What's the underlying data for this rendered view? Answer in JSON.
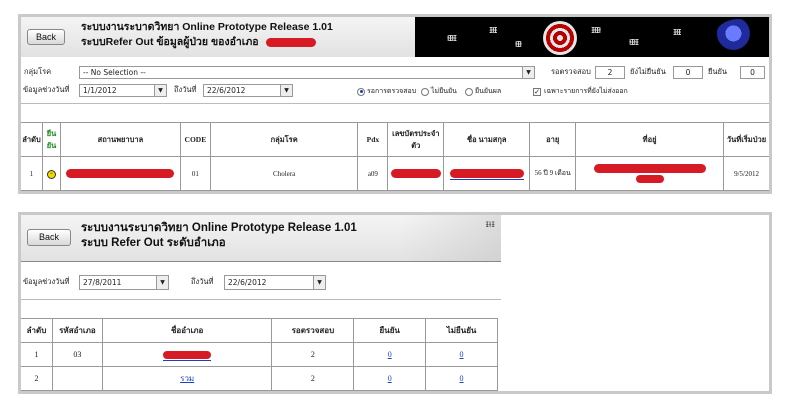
{
  "colors": {
    "redaction": "#d61b24",
    "link": "#1740c7",
    "confirm_header": "#1a8a1a",
    "border": "#c9c9c9"
  },
  "panel1": {
    "back_label": "Back",
    "title_line1": "ระบบงานระบาดวิทยา Online Prototype Release 1.01",
    "title_line2": "ระบบRefer Out ข้อมูลผู้ป่วย ของอำเภอ",
    "filters": {
      "disease_group_label": "กลุ่มโรค",
      "disease_group_value": "-- No Selection --",
      "pending_label": "รอตรวจสอบ",
      "pending_value": "2",
      "not_confirmed_label": "ยังไม่ยืนยัน",
      "not_confirmed_value": "0",
      "confirmed_label": "ยืนยัน",
      "confirmed_value": "0",
      "date_range_label": "ข้อมูลช่วงวันที่",
      "date_from": "1/1/2012",
      "date_to_label": "ถึงวันที่",
      "date_to": "22/6/2012",
      "radio_pending": "รอการตรวจสอบ",
      "radio_unconfirmed": "ไม่ยืนยัน",
      "radio_confirmed": "ยืนยันผล",
      "checkbox_label": "เฉพาะรายการที่ยังไม่ส่งออก",
      "checkbox_checked": true
    },
    "table": {
      "headers": [
        "ลำดับ",
        "ยืน ยัน",
        "สถานพยาบาล",
        "CODE",
        "กลุ่มโรค",
        "Pdx",
        "เลขบัตรประจำ ตัว",
        "ชื่อ นามสกุล",
        "อายุ",
        "ที่อยู่",
        "วันที่เริ่มป่วย"
      ],
      "rows": [
        {
          "no": "1",
          "flag": "Yellow",
          "code": "01",
          "disease": "Cholera",
          "pdx": "a09",
          "age": "56 ปี 9 เดือน",
          "onset": "9/5/2012"
        }
      ]
    }
  },
  "panel2": {
    "back_label": "Back",
    "title_line1": "ระบบงานระบาดวิทยา Online Prototype Release 1.01",
    "title_line2": "ระบบ Refer Out ระดับอำเภอ",
    "date_range_label": "ข้อมูลช่วงวันที่",
    "date_from": "27/8/2011",
    "date_to_label": "ถึงวันที่",
    "date_to": "22/6/2012",
    "table": {
      "headers": [
        "ลำดับ",
        "รหัสอำเภอ",
        "ชื่ออำเภอ",
        "รอตรวจสอบ",
        "ยืนยัน",
        "ไม่ยืนยัน"
      ],
      "rows": [
        {
          "no": "1",
          "code": "03",
          "name": "",
          "pending": "2",
          "confirmed": "0",
          "unconfirmed": "0"
        },
        {
          "no": "2",
          "code": "",
          "name": "รวม",
          "pending": "2",
          "confirmed": "0",
          "unconfirmed": "0"
        }
      ]
    }
  }
}
